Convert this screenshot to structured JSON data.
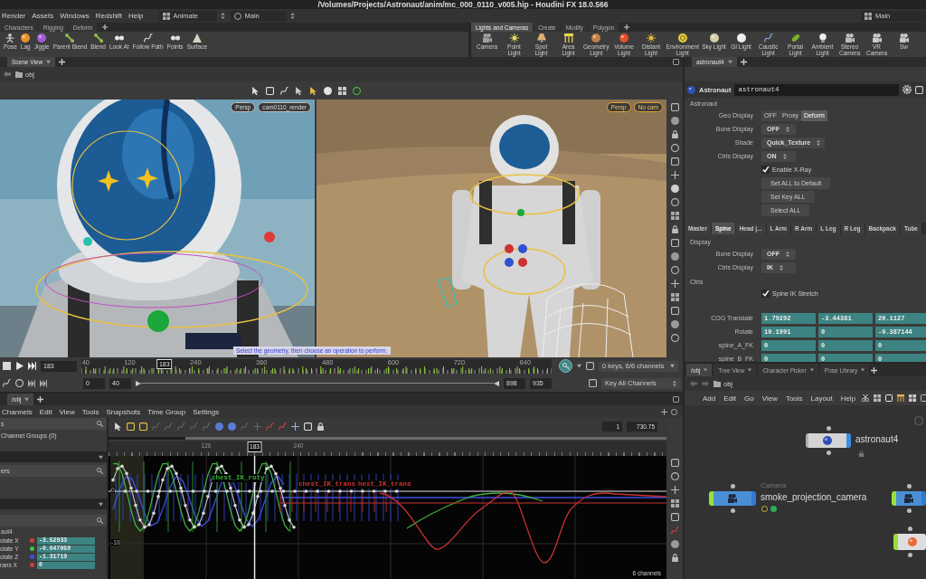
{
  "title_bar": {
    "title": "/Volumes/Projects/Astronaut/anim/mc_000_0110_v005.hip - Houdini FX 18.0.566"
  },
  "menu_bar": {
    "items": [
      "Render",
      "Assets",
      "Windows",
      "Redshift",
      "Help"
    ],
    "desktop": "Animate",
    "context": "Main",
    "right_context": "Main"
  },
  "shelf_left": {
    "tabs": [
      {
        "label": "Characters",
        "selected": false
      },
      {
        "label": "Rigging",
        "selected": false
      },
      {
        "label": "Deform",
        "selected": false
      }
    ],
    "tools": [
      "Pose",
      "Lag",
      "Jiggle",
      "Parent Blend",
      "Blend",
      "Look At",
      "Follow Path",
      "Points",
      "Surface"
    ]
  },
  "shelf_right": {
    "tabs": [
      {
        "label": "Lights and Cameras",
        "selected": true
      },
      {
        "label": "Create",
        "selected": false
      },
      {
        "label": "Modify",
        "selected": false
      },
      {
        "label": "Polygon",
        "selected": false
      }
    ],
    "tools": [
      "Camera",
      "Point Light",
      "Spot Light",
      "Area Light",
      "Geometry Light",
      "Volume Light",
      "Distant Light",
      "Environment Light",
      "Sky Light",
      "GI Light",
      "Caustic Light",
      "Portal Light",
      "Ambient Light",
      "Stereo Camera",
      "VR Camera",
      "Sw"
    ]
  },
  "scene_view": {
    "tabs": [
      {
        "label": "Scene View",
        "selected": true
      }
    ],
    "path": "obj",
    "panes": [
      {
        "projection": "Persp",
        "camera": "cam0110_render",
        "selected": false
      },
      {
        "projection": "Persp",
        "camera": "No cam",
        "selected": true
      }
    ],
    "prompt": "Select the geometry, then choose an operation to perform."
  },
  "timeline": {
    "frame": "183",
    "ruler": [
      "40",
      "120",
      "240",
      "360",
      "480",
      "600",
      "720",
      "840"
    ],
    "marker": "183",
    "keys_menu": "0 keys, 6/6 channels",
    "range_start": "0",
    "play_start": "40",
    "play_end": "898",
    "range_end": "935",
    "key_menu": "Key All Channels"
  },
  "channel_editor": {
    "tabs": [
      {
        "label": "/obj",
        "selected": true
      }
    ],
    "menu": [
      "Channels",
      "Edit",
      "View",
      "Tools",
      "Snapshots",
      "Time Group",
      "Settings"
    ],
    "groups_header": "s",
    "group_item": "Channel Groups (0)",
    "filter_header": "ers",
    "node": "aut4",
    "channels": [
      {
        "name": "otate X",
        "color": "#d23c3c",
        "value": "-3.52933"
      },
      {
        "name": "otate Y",
        "color": "#3cc83c",
        "value": "-0.647059"
      },
      {
        "name": "otate Z",
        "color": "#3c50dc",
        "value": "-1.31719"
      },
      {
        "name": "rans X",
        "color": "#d23c3c",
        "value": "0"
      }
    ],
    "frame_start": "1",
    "frame_end": "730.75",
    "ruler": [
      "120",
      "240"
    ],
    "marker": "183",
    "y_labels": [
      "0",
      "-10"
    ],
    "curve_labels": [
      {
        "text": "chest_IK_roty",
        "color": "#3fae3f"
      },
      {
        "text": "chest_IK_trans",
        "color": "#c83232"
      },
      {
        "text": "hest_IK_trans",
        "color": "#c83232"
      }
    ],
    "footer": "6 channels"
  },
  "parameters": {
    "pane_tab": {
      "label": "astronaut4",
      "selected": true
    },
    "node_type": "Astronaut",
    "node_name": "astronaut4",
    "folder": "Astronaut",
    "rows": [
      {
        "kind": "buttons",
        "label": "Geo Display",
        "options": [
          {
            "label": "OFF",
            "selected": false
          },
          {
            "label": "Proxy",
            "selected": false
          },
          {
            "label": "Deform",
            "selected": true
          }
        ]
      },
      {
        "kind": "menu",
        "label": "Bone Display",
        "value": "OFF"
      },
      {
        "kind": "menu",
        "label": "Shade",
        "value": "Quick_Texture"
      },
      {
        "kind": "menu",
        "label": "Ctrls Display",
        "value": "ON"
      },
      {
        "kind": "checkbox",
        "label": "Enable X-Ray",
        "checked": true
      },
      {
        "kind": "button",
        "label": "Set ALL to Default"
      },
      {
        "kind": "button",
        "label": "Set Key ALL"
      },
      {
        "kind": "button",
        "label": "Select ALL"
      }
    ],
    "tabs": [
      {
        "label": "Master",
        "selected": false
      },
      {
        "label": "Spine",
        "selected": true
      },
      {
        "label": "Head |...",
        "selected": false
      },
      {
        "label": "L Arm",
        "selected": false
      },
      {
        "label": "R Arm",
        "selected": false
      },
      {
        "label": "L Leg",
        "selected": false
      },
      {
        "label": "R Leg",
        "selected": false
      },
      {
        "label": "Backpack",
        "selected": false
      },
      {
        "label": "Tube",
        "selected": false
      }
    ],
    "sections": [
      {
        "label": "Display",
        "rows": [
          {
            "kind": "menu",
            "label": "Bone Display",
            "value": "OFF"
          },
          {
            "kind": "menu",
            "label": "Ctrls Display",
            "value": "IK"
          }
        ]
      },
      {
        "label": "Ctrls",
        "rows": [
          {
            "kind": "checkbox",
            "label": "Spine IK Stretch",
            "checked": true
          },
          {
            "kind": "vector",
            "label": "COG Translate",
            "values": [
              "1.79292",
              "-3.44381",
              "20.1127"
            ]
          },
          {
            "kind": "vector",
            "label": "Rotate",
            "values": [
              "10.1991",
              "0",
              "-0.387144"
            ]
          },
          {
            "kind": "vector",
            "label": "spine_A_FK",
            "values": [
              "0",
              "0",
              "0"
            ]
          },
          {
            "kind": "vector",
            "label": "spine_B_FK",
            "values": [
              "0",
              "0",
              "0"
            ]
          }
        ]
      }
    ]
  },
  "network": {
    "tabs": [
      {
        "label": "/obj",
        "selected": true
      },
      {
        "label": "Tree View",
        "selected": false
      },
      {
        "label": "Character Picker",
        "selected": false
      },
      {
        "label": "Pose Library",
        "selected": false
      }
    ],
    "path": "obj",
    "menu": [
      "Add",
      "Edit",
      "Go",
      "View",
      "Tools",
      "Layout",
      "Help"
    ],
    "corner_label": "O",
    "nodes": [
      {
        "kind": "character",
        "name": "astronaut4",
        "locked": true
      },
      {
        "kind": "camera",
        "type": "Camera",
        "name": "smoke_projection_camera"
      },
      {
        "kind": "camera"
      },
      {
        "kind": "light"
      }
    ]
  }
}
